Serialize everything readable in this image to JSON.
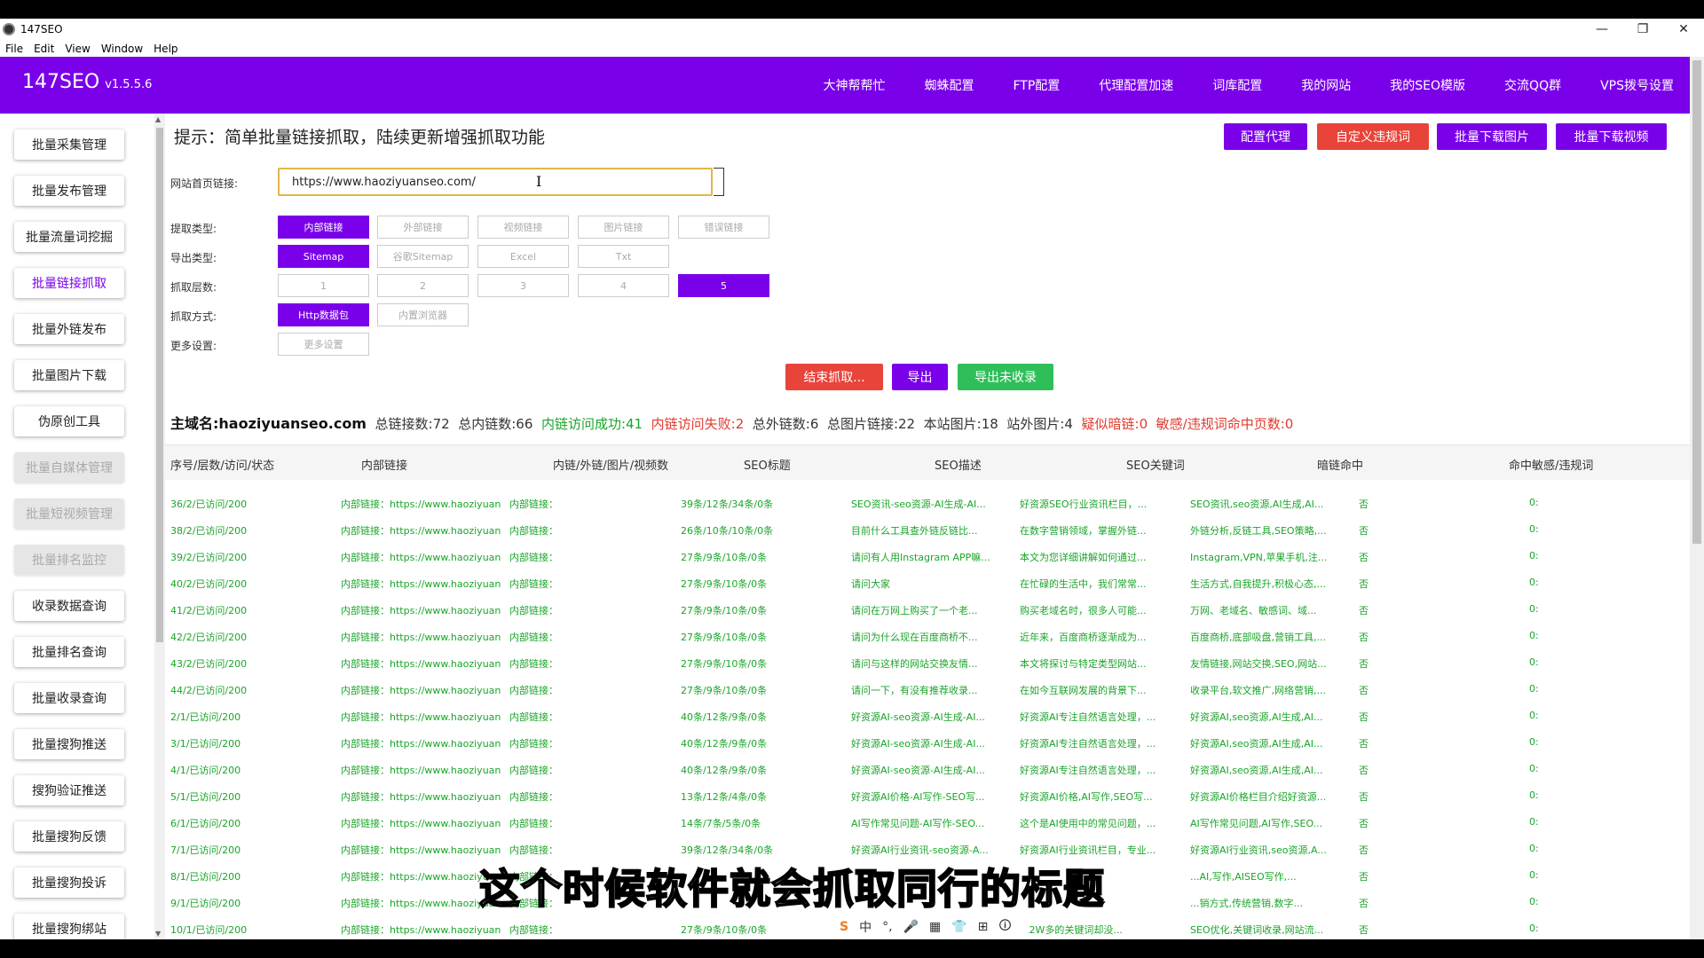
{
  "window": {
    "title": "147SEO",
    "controls": [
      "—",
      "❐",
      "✕"
    ]
  },
  "menu": [
    "File",
    "Edit",
    "View",
    "Window",
    "Help"
  ],
  "brand": {
    "name": "147SEO",
    "version": "v1.5.5.6"
  },
  "nav": [
    "大神帮帮忙",
    "蜘蛛配置",
    "FTP配置",
    "代理配置加速",
    "词库配置",
    "我的网站",
    "我的SEO模版",
    "交流QQ群",
    "VPS拨号设置"
  ],
  "sidebar": [
    {
      "label": "批量采集管理",
      "state": "normal"
    },
    {
      "label": "批量发布管理",
      "state": "normal"
    },
    {
      "label": "批量流量词挖掘",
      "state": "normal"
    },
    {
      "label": "批量链接抓取",
      "state": "active"
    },
    {
      "label": "批量外链发布",
      "state": "normal"
    },
    {
      "label": "批量图片下载",
      "state": "normal"
    },
    {
      "label": "伪原创工具",
      "state": "normal"
    },
    {
      "label": "批量自媒体管理",
      "state": "disabled"
    },
    {
      "label": "批量短视频管理",
      "state": "disabled"
    },
    {
      "label": "批量排名监控",
      "state": "disabled"
    },
    {
      "label": "收录数据查询",
      "state": "normal"
    },
    {
      "label": "批量排名查询",
      "state": "normal"
    },
    {
      "label": "批量收录查询",
      "state": "normal"
    },
    {
      "label": "批量搜狗推送",
      "state": "normal"
    },
    {
      "label": "搜狗验证推送",
      "state": "normal"
    },
    {
      "label": "批量搜狗反馈",
      "state": "normal"
    },
    {
      "label": "批量搜狗投诉",
      "state": "normal"
    },
    {
      "label": "批量搜狗绑站",
      "state": "normal"
    }
  ],
  "tip": "提示：简单批量链接抓取，陆续更新增强抓取功能",
  "top_buttons": [
    "配置代理",
    "自定义违规词",
    "批量下载图片",
    "批量下载视频"
  ],
  "form": {
    "url_label": "网站首页链接:",
    "url_value": "https://www.haoziyuanseo.com/",
    "extract_label": "提取类型:",
    "extract_options": [
      "内部链接",
      "外部链接",
      "视频链接",
      "图片链接",
      "错误链接"
    ],
    "export_label": "导出类型:",
    "export_options": [
      "Sitemap",
      "谷歌Sitemap",
      "Excel",
      "Txt"
    ],
    "depth_label": "抓取层数:",
    "depth_options": [
      "1",
      "2",
      "3",
      "4",
      "5"
    ],
    "method_label": "抓取方式:",
    "method_options": [
      "Http数据包",
      "内置浏览器"
    ],
    "more_label": "更多设置:",
    "more_button": "更多设置"
  },
  "actions": [
    "结束抓取...",
    "导出",
    "导出未收录"
  ],
  "stats": {
    "domain": "主域名:haoziyuanseo.com",
    "total_links": "总链接数:72",
    "internal": "总内链数:66",
    "ok": "内链访问成功:41",
    "fail": "内链访问失败:2",
    "external": "总外链数:6",
    "images": "总图片链接:22",
    "site_images": "本站图片:18",
    "ext_images": "站外图片:4",
    "dark": "疑似暗链:0",
    "sensitive": "敏感/违规词命中页数:0"
  },
  "table": {
    "headers": [
      "序号/层数/访问/状态",
      "内部链接",
      "内链/外链/图片/视频数",
      "SEO标题",
      "SEO描述",
      "SEO关键词",
      "暗链命中",
      "命中敏感/违规词"
    ],
    "rows": [
      [
        "36/2/已访问/200",
        "内部链接：https://www.haoziyuan",
        "内部链接：",
        "39条/12条/34条/0条",
        "SEO资讯-seo资源-AI生成-AI...",
        "好资源SEO行业资讯栏目，...",
        "SEO资讯,seo资源,AI生成,AI...",
        "否",
        "0:"
      ],
      [
        "38/2/已访问/200",
        "内部链接：https://www.haoziyuan",
        "内部链接：",
        "26条/10条/10条/0条",
        "目前什么工具查外链反链比...",
        "在数字营销领域，掌握外链...",
        "外链分析,反链工具,SEO策略,...",
        "否",
        "0:"
      ],
      [
        "39/2/已访问/200",
        "内部链接：https://www.haoziyuan",
        "内部链接：",
        "27条/9条/10条/0条",
        "请问有人用Instagram APP嘛...",
        "本文为您详细讲解如何通过...",
        "Instagram,VPN,苹果手机,注...",
        "否",
        "0:"
      ],
      [
        "40/2/已访问/200",
        "内部链接：https://www.haoziyuan",
        "内部链接：",
        "27条/9条/10条/0条",
        "请问大家",
        "在忙碌的生活中，我们常常...",
        "生活方式,自我提升,积极心态,...",
        "否",
        "0:"
      ],
      [
        "41/2/已访问/200",
        "内部链接：https://www.haoziyuan",
        "内部链接：",
        "27条/9条/10条/0条",
        "请问在万网上购买了一个老...",
        "购买老域名时，很多人可能...",
        "万网、老域名、敏感词、域...",
        "否",
        "0:"
      ],
      [
        "42/2/已访问/200",
        "内部链接：https://www.haoziyuan",
        "内部链接：",
        "27条/9条/10条/0条",
        "请问为什么现在百度商桥不...",
        "近年来，百度商桥逐渐成为...",
        "百度商桥,底部吸盘,营销工具,...",
        "否",
        "0:"
      ],
      [
        "43/2/已访问/200",
        "内部链接：https://www.haoziyuan",
        "内部链接：",
        "27条/9条/10条/0条",
        "请问与这样的网站交换友情...",
        "本文将探讨与特定类型网站...",
        "友情链接,网站交换,SEO,网站...",
        "否",
        "0:"
      ],
      [
        "44/2/已访问/200",
        "内部链接：https://www.haoziyuan",
        "内部链接：",
        "27条/9条/10条/0条",
        "请问一下，有没有推荐收录...",
        "在如今互联网发展的背景下...",
        "收录平台,软文推广,网络营销,...",
        "否",
        "0:"
      ],
      [
        "2/1/已访问/200",
        "内部链接：https://www.haoziyuan",
        "内部链接：",
        "40条/12条/9条/0条",
        "好资源AI-seo资源-AI生成-AI...",
        "好资源AI专注自然语言处理，...",
        "好资源AI,seo资源,AI生成,AI...",
        "否",
        "0:"
      ],
      [
        "3/1/已访问/200",
        "内部链接：https://www.haoziyuan",
        "内部链接：",
        "40条/12条/9条/0条",
        "好资源AI-seo资源-AI生成-AI...",
        "好资源AI专注自然语言处理，...",
        "好资源AI,seo资源,AI生成,AI...",
        "否",
        "0:"
      ],
      [
        "4/1/已访问/200",
        "内部链接：https://www.haoziyuan",
        "内部链接：",
        "40条/12条/9条/0条",
        "好资源AI-seo资源-AI生成-AI...",
        "好资源AI专注自然语言处理，...",
        "好资源AI,seo资源,AI生成,AI...",
        "否",
        "0:"
      ],
      [
        "5/1/已访问/200",
        "内部链接：https://www.haoziyuan",
        "内部链接：",
        "13条/12条/4条/0条",
        "好资源AI价格-AI写作-SEO写...",
        "好资源AI价格,AI写作,SEO写...",
        "好资源AI价格栏目介绍好资源...",
        "否",
        "0:"
      ],
      [
        "6/1/已访问/200",
        "内部链接：https://www.haoziyuan",
        "内部链接：",
        "14条/7条/5条/0条",
        "AI写作常见问题-AI写作-SEO...",
        "这个是AI使用中的常见问题，...",
        "AI写作常见问题,AI写作,SEO...",
        "否",
        "0:"
      ],
      [
        "7/1/已访问/200",
        "内部链接：https://www.haoziyuan",
        "内部链接：",
        "39条/12条/34条/0条",
        "好资源AI行业资讯-seo资源-A...",
        "好资源AI行业资讯栏目，专业...",
        "好资源AI行业资讯,seo资源,A...",
        "否",
        "0:"
      ],
      [
        "8/1/已访问/200",
        "内部链接：https://www.haoziyuan",
        "内部链接：",
        "",
        "",
        "",
        "...AI,写作,AISEO写作,...",
        "否",
        "0:"
      ],
      [
        "9/1/已访问/200",
        "内部链接：https://www.haoziyuan",
        "内部链接：",
        "",
        "",
        "",
        "...销方式,传统营销,数字...",
        "否",
        "0:"
      ],
      [
        "10/1/已访问/200",
        "内部链接：https://www.haoziyuan",
        "内部链接：",
        "27条/9条/10条/0条",
        "",
        "...2W多的关键词却没...",
        "SEO优化,关键词收录,网站流...",
        "否",
        "0:"
      ]
    ]
  },
  "subtitle": "这个时候软件就会抓取同行的标题",
  "ime_bar": [
    "S",
    "中",
    "°,",
    "🎤",
    "▦",
    "👕",
    "⊞",
    "🛈"
  ]
}
